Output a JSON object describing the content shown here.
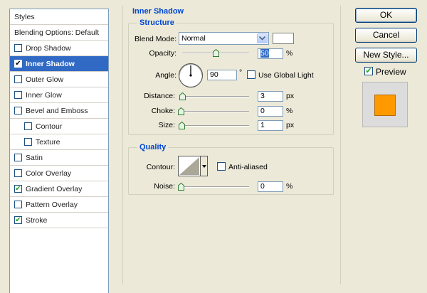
{
  "styles_list": {
    "header": "Styles",
    "items": [
      {
        "label": "Blending Options: Default",
        "checkbox": false,
        "checked": false,
        "selected": false,
        "indent": false,
        "name": "blending-options"
      },
      {
        "label": "Drop Shadow",
        "checkbox": true,
        "checked": false,
        "selected": false,
        "indent": false,
        "name": "drop-shadow"
      },
      {
        "label": "Inner Shadow",
        "checkbox": true,
        "checked": true,
        "selected": true,
        "indent": false,
        "name": "inner-shadow"
      },
      {
        "label": "Outer Glow",
        "checkbox": true,
        "checked": false,
        "selected": false,
        "indent": false,
        "name": "outer-glow"
      },
      {
        "label": "Inner Glow",
        "checkbox": true,
        "checked": false,
        "selected": false,
        "indent": false,
        "name": "inner-glow"
      },
      {
        "label": "Bevel and Emboss",
        "checkbox": true,
        "checked": false,
        "selected": false,
        "indent": false,
        "name": "bevel-and-emboss"
      },
      {
        "label": "Contour",
        "checkbox": true,
        "checked": false,
        "selected": false,
        "indent": true,
        "name": "contour"
      },
      {
        "label": "Texture",
        "checkbox": true,
        "checked": false,
        "selected": false,
        "indent": true,
        "name": "texture"
      },
      {
        "label": "Satin",
        "checkbox": true,
        "checked": false,
        "selected": false,
        "indent": false,
        "name": "satin"
      },
      {
        "label": "Color Overlay",
        "checkbox": true,
        "checked": false,
        "selected": false,
        "indent": false,
        "name": "color-overlay"
      },
      {
        "label": "Gradient Overlay",
        "checkbox": true,
        "checked": true,
        "selected": false,
        "indent": false,
        "name": "gradient-overlay"
      },
      {
        "label": "Pattern Overlay",
        "checkbox": true,
        "checked": false,
        "selected": false,
        "indent": false,
        "name": "pattern-overlay"
      },
      {
        "label": "Stroke",
        "checkbox": true,
        "checked": true,
        "selected": false,
        "indent": false,
        "name": "stroke"
      }
    ]
  },
  "panel": {
    "title": "Inner Shadow",
    "structure": {
      "title": "Structure",
      "blend_mode_label": "Blend Mode:",
      "blend_mode_value": "Normal",
      "shadow_color": "#ffffff",
      "opacity_label": "Opacity:",
      "opacity_value": "50",
      "opacity_unit": "%",
      "angle_label": "Angle:",
      "angle_value": "90",
      "angle_unit": "°",
      "use_global_light_label": "Use Global Light",
      "use_global_light_checked": false,
      "distance_label": "Distance:",
      "distance_value": "3",
      "distance_unit": "px",
      "choke_label": "Choke:",
      "choke_value": "0",
      "choke_unit": "%",
      "size_label": "Size:",
      "size_value": "1",
      "size_unit": "px"
    },
    "quality": {
      "title": "Quality",
      "contour_label": "Contour:",
      "anti_aliased_label": "Anti-aliased",
      "anti_aliased_checked": false,
      "noise_label": "Noise:",
      "noise_value": "0",
      "noise_unit": "%"
    }
  },
  "actions": {
    "ok_label": "OK",
    "cancel_label": "Cancel",
    "new_style_label": "New Style...",
    "preview_label": "Preview",
    "preview_checked": true,
    "preview_swatch_color": "#ff9900"
  },
  "colors": {
    "accent_blue": "#0046d5",
    "selection": "#316ac5",
    "check_green": "#21a121"
  }
}
